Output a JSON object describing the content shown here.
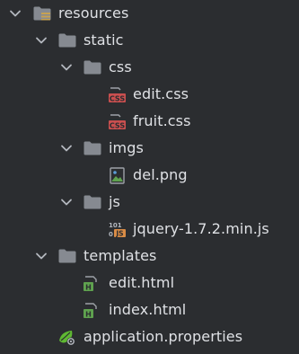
{
  "tree": {
    "root": {
      "label": "resources",
      "icon": "folder-resources-icon"
    },
    "static": {
      "label": "static",
      "icon": "folder-icon"
    },
    "css": {
      "label": "css",
      "icon": "folder-icon"
    },
    "edit_css": {
      "label": "edit.css",
      "icon": "css-file-icon",
      "badge": "CSS"
    },
    "fruit_css": {
      "label": "fruit.css",
      "icon": "css-file-icon",
      "badge": "CSS"
    },
    "imgs": {
      "label": "imgs",
      "icon": "folder-icon"
    },
    "del_png": {
      "label": "del.png",
      "icon": "image-file-icon"
    },
    "js": {
      "label": "js",
      "icon": "folder-icon"
    },
    "jquery": {
      "label": "jquery-1.7.2.min.js",
      "icon": "js-file-icon",
      "badge": "JS",
      "bits_top": "101",
      "bits_bottom": "0"
    },
    "templates": {
      "label": "templates",
      "icon": "folder-icon"
    },
    "edit_html": {
      "label": "edit.html",
      "icon": "html-file-icon",
      "badge": "H"
    },
    "index_html": {
      "label": "index.html",
      "icon": "html-file-icon",
      "badge": "H"
    },
    "app_props": {
      "label": "application.properties",
      "icon": "spring-properties-icon"
    }
  },
  "colors": {
    "background": "#2b2d30",
    "text": "#dfe1e5",
    "chevron": "#b4b8bf",
    "folder": "#868a91",
    "css_badge": "#c94f4f",
    "js_badge": "#d98c46",
    "html_badge": "#5fa24f",
    "spring": "#5fb832"
  }
}
